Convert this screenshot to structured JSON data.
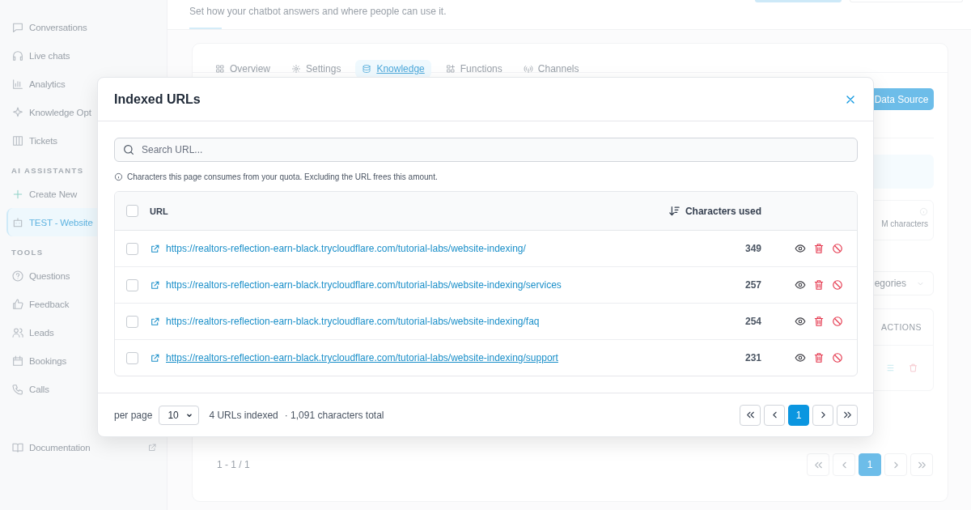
{
  "sidebar": {
    "groups": [
      {
        "items": [
          {
            "label": "Conversations",
            "selected": false
          },
          {
            "label": "Live chats",
            "selected": false
          },
          {
            "label": "Analytics",
            "selected": false
          },
          {
            "label": "Knowledge Opt",
            "selected": false
          },
          {
            "label": "Tickets",
            "selected": false
          }
        ]
      },
      {
        "heading": "AI ASSISTANTS",
        "items": [
          {
            "label": "Create New",
            "selected": false
          },
          {
            "label": "TEST - Website",
            "selected": true
          }
        ]
      },
      {
        "heading": "TOOLS",
        "items": [
          {
            "label": "Questions",
            "selected": false
          },
          {
            "label": "Feedback",
            "selected": false
          },
          {
            "label": "Leads",
            "selected": false
          },
          {
            "label": "Bookings",
            "selected": false
          },
          {
            "label": "Calls",
            "selected": false
          }
        ]
      }
    ],
    "footer_link": "Documentation"
  },
  "header": {
    "subtitle": "Set how your chatbot answers and where people can use it."
  },
  "card": {
    "tabs": [
      {
        "label": "Overview",
        "selected": false
      },
      {
        "label": "Settings",
        "selected": false
      },
      {
        "label": "Knowledge",
        "selected": true
      },
      {
        "label": "Functions",
        "selected": false
      },
      {
        "label": "Channels",
        "selected": false
      }
    ],
    "add_button": "Data Source",
    "usage_text": "M characters",
    "category_select": "egories",
    "table_header": "ACTIONS",
    "range": "1 - 1 / 1",
    "pages": [
      {
        "label": "1",
        "selected": true
      }
    ]
  },
  "modal": {
    "title": "Indexed URLs",
    "search": {
      "placeholder": "Search URL..."
    },
    "note": "Characters this page consumes from your quota. Excluding the URL frees this amount.",
    "table": {
      "columns": [
        "URL",
        "Characters used"
      ],
      "all_checked": false,
      "rows": [
        {
          "url": "https://realtors-reflection-earn-black.trycloudflare.com/tutorial-labs/website-indexing/",
          "characters": "349",
          "checked": false,
          "hovered": false
        },
        {
          "url": "https://realtors-reflection-earn-black.trycloudflare.com/tutorial-labs/website-indexing/services",
          "characters": "257",
          "checked": false,
          "hovered": false
        },
        {
          "url": "https://realtors-reflection-earn-black.trycloudflare.com/tutorial-labs/website-indexing/faq",
          "characters": "254",
          "checked": false,
          "hovered": false
        },
        {
          "url": "https://realtors-reflection-earn-black.trycloudflare.com/tutorial-labs/website-indexing/support",
          "characters": "231",
          "checked": false,
          "hovered": true
        }
      ]
    },
    "footer": {
      "per_page_label": "per page",
      "per_page": "10",
      "count": "4 URLs indexed",
      "total": "· 1,091 characters total",
      "pages": [
        {
          "label": "1",
          "selected": true
        }
      ]
    }
  }
}
